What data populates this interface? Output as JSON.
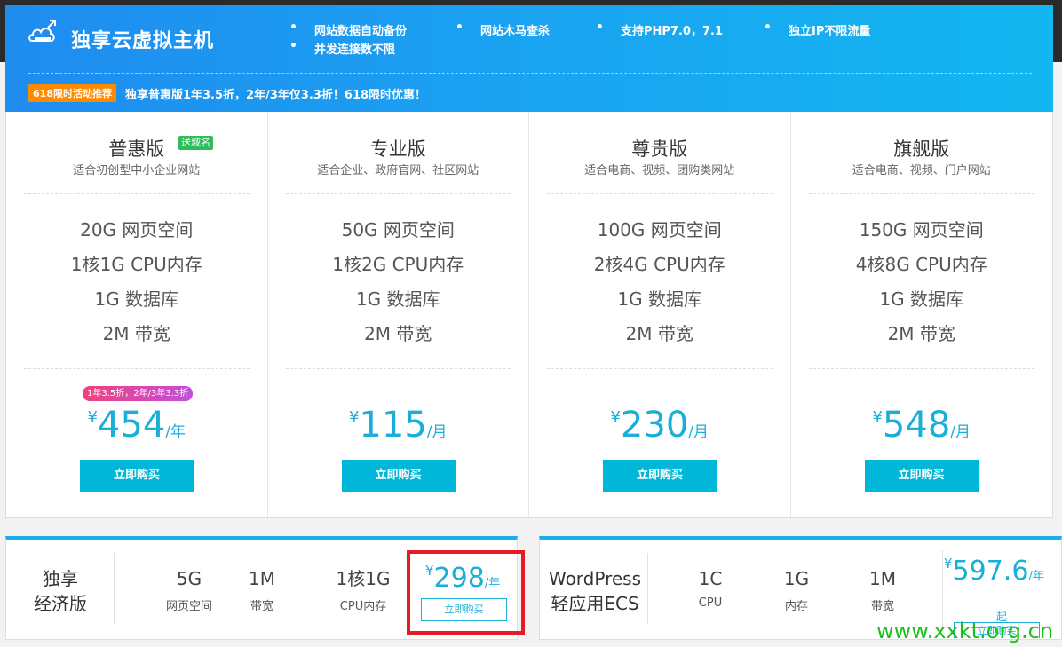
{
  "banner": {
    "title": "独享云虚拟主机",
    "features": [
      "网站数据自动备份",
      "网站木马查杀",
      "支持PHP7.0，7.1",
      "独立IP不限流量",
      "并发连接数不限"
    ],
    "promo_badge": "618限时活动推荐",
    "promo_text": "独享普惠版1年3.5折，2年/3年仅3.3折！618限时优惠！"
  },
  "plans": [
    {
      "name": "普惠版",
      "tag": "送域名",
      "desc": "适合初创型中小企业网站",
      "specs": [
        "20G 网页空间",
        "1核1G CPU内存",
        "1G 数据库",
        "2M 带宽"
      ],
      "discount": "1年3.5折，2年/3年3.3折",
      "currency": "¥",
      "price": "454",
      "unit": "/年",
      "buy": "立即购买"
    },
    {
      "name": "专业版",
      "desc": "适合企业、政府官网、社区网站",
      "specs": [
        "50G 网页空间",
        "1核2G CPU内存",
        "1G 数据库",
        "2M 带宽"
      ],
      "currency": "¥",
      "price": "115",
      "unit": "/月",
      "buy": "立即购买"
    },
    {
      "name": "尊贵版",
      "desc": "适合电商、视频、团购类网站",
      "specs": [
        "100G 网页空间",
        "2核4G CPU内存",
        "1G 数据库",
        "2M 带宽"
      ],
      "currency": "¥",
      "price": "230",
      "unit": "/月",
      "buy": "立即购买"
    },
    {
      "name": "旗舰版",
      "desc": "适合电商、视频、门户网站",
      "specs": [
        "150G 网页空间",
        "4核8G CPU内存",
        "1G 数据库",
        "2M 带宽"
      ],
      "currency": "¥",
      "price": "548",
      "unit": "/月",
      "buy": "立即购买"
    }
  ],
  "economy": {
    "title_line1": "独享",
    "title_line2": "经济版",
    "items": [
      {
        "big": "5G",
        "small": "网页空间"
      },
      {
        "big": "1M",
        "small": "带宽"
      },
      {
        "big": "1核1G",
        "small": "CPU内存"
      }
    ],
    "currency": "¥",
    "price": "298",
    "unit": "/年",
    "buy": "立即购买"
  },
  "ecs": {
    "title_line1": "WordPress",
    "title_line2": "轻应用ECS",
    "items": [
      {
        "big": "1C",
        "small": "CPU"
      },
      {
        "big": "1G",
        "small": "内存"
      },
      {
        "big": "1M",
        "small": "带宽"
      }
    ],
    "currency": "¥",
    "price": "597.6",
    "unit": "/年",
    "suffix": "起",
    "buy": "立即购买"
  },
  "watermark": "www.xxkt.org.cn"
}
